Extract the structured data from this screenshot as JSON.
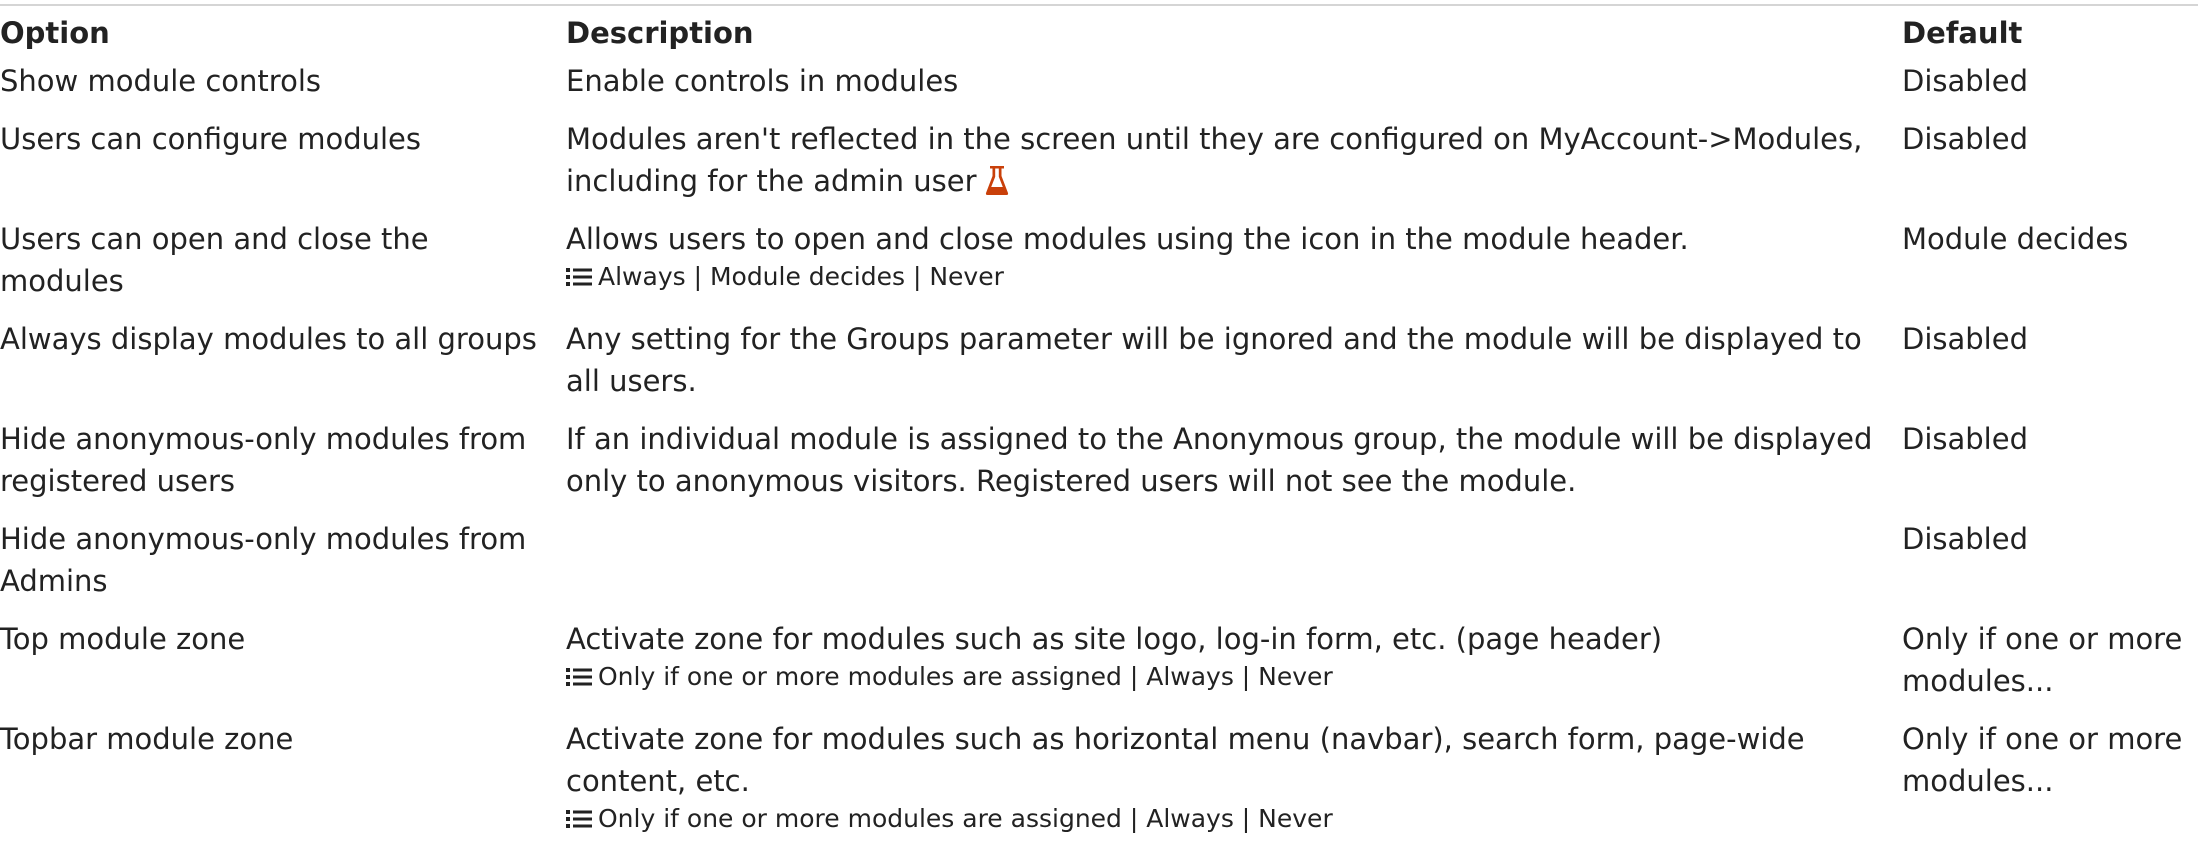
{
  "table": {
    "headers": {
      "option": "Option",
      "description": "Description",
      "default": "Default"
    },
    "rows": [
      {
        "option": "Show module controls",
        "description": "Enable controls in modules",
        "default": "Disabled"
      },
      {
        "option": "Users can configure modules",
        "description": "Modules aren't reflected in the screen until they are configured on MyAccount->Modules, including for the admin user",
        "default": "Disabled",
        "icon": "flask-icon"
      },
      {
        "option": "Users can open and close the modules",
        "description": "Allows users to open and close modules using the icon in the module header.",
        "choices": "Always | Module decides | Never",
        "default": "Module decides"
      },
      {
        "option": "Always display modules to all groups",
        "description": "Any setting for the Groups parameter will be ignored and the module will be displayed to all users.",
        "default": "Disabled"
      },
      {
        "option": "Hide anonymous-only modules from registered users",
        "description": "If an individual module is assigned to the Anonymous group, the module will be displayed only to anonymous visitors. Registered users will not see the module.",
        "default": "Disabled"
      },
      {
        "option": "Hide anonymous-only modules from Admins",
        "description": "",
        "default": "Disabled"
      },
      {
        "option": "Top module zone",
        "description": "Activate zone for modules such as site logo, log-in form, etc. (page header)",
        "choices": "Only if one or more modules are assigned | Always | Never",
        "default": "Only if one or more modules..."
      },
      {
        "option": "Topbar module zone",
        "description": "Activate zone for modules such as horizontal menu (navbar), search form, page-wide content, etc.",
        "choices": "Only if one or more modules are assigned | Always | Never",
        "default": "Only if one or more modules..."
      }
    ]
  },
  "colors": {
    "text": "#222222",
    "experimental_icon": "#c9400a",
    "rule": "#d5d5d5"
  },
  "icons": {
    "choices": "list-icon",
    "experimental": "flask-icon"
  }
}
